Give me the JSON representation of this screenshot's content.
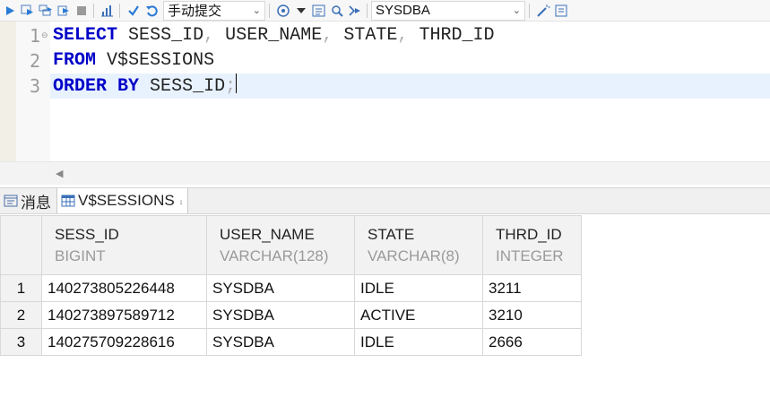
{
  "toolbar": {
    "commit_mode": "手动提交",
    "connection_user": "SYSDBA",
    "icons": [
      "run-icon",
      "run-new-tab-icon",
      "run-script-icon",
      "run-selection-icon",
      "stop-icon",
      "explain-icon",
      "commit-icon",
      "rollback-icon",
      "target-icon",
      "dropdown-arrow-icon",
      "format-icon",
      "find-icon",
      "navigate-icon",
      "magic-icon",
      "layout-icon"
    ]
  },
  "editor": {
    "lines": [
      {
        "num": "1",
        "kw1": "SELECT",
        "rest": " SESS_ID, USER_NAME, STATE, THRD_ID"
      },
      {
        "num": "2",
        "kw1": "FROM",
        "rest": " V$SESSIONS"
      },
      {
        "num": "3",
        "kw1": "ORDER BY",
        "rest": " SESS_ID;"
      }
    ]
  },
  "tabs": [
    {
      "label": "消息"
    },
    {
      "label": "V$SESSIONS"
    }
  ],
  "result": {
    "columns": [
      {
        "name": "SESS_ID",
        "type": "BIGINT"
      },
      {
        "name": "USER_NAME",
        "type": "VARCHAR(128)"
      },
      {
        "name": "STATE",
        "type": "VARCHAR(8)"
      },
      {
        "name": "THRD_ID",
        "type": "INTEGER"
      }
    ],
    "rows": [
      {
        "n": "1",
        "c": [
          "140273805226448",
          "SYSDBA",
          "IDLE",
          "3211"
        ]
      },
      {
        "n": "2",
        "c": [
          "140273897589712",
          "SYSDBA",
          "ACTIVE",
          "3210"
        ]
      },
      {
        "n": "3",
        "c": [
          "140275709228616",
          "SYSDBA",
          "IDLE",
          "2666"
        ]
      }
    ]
  }
}
